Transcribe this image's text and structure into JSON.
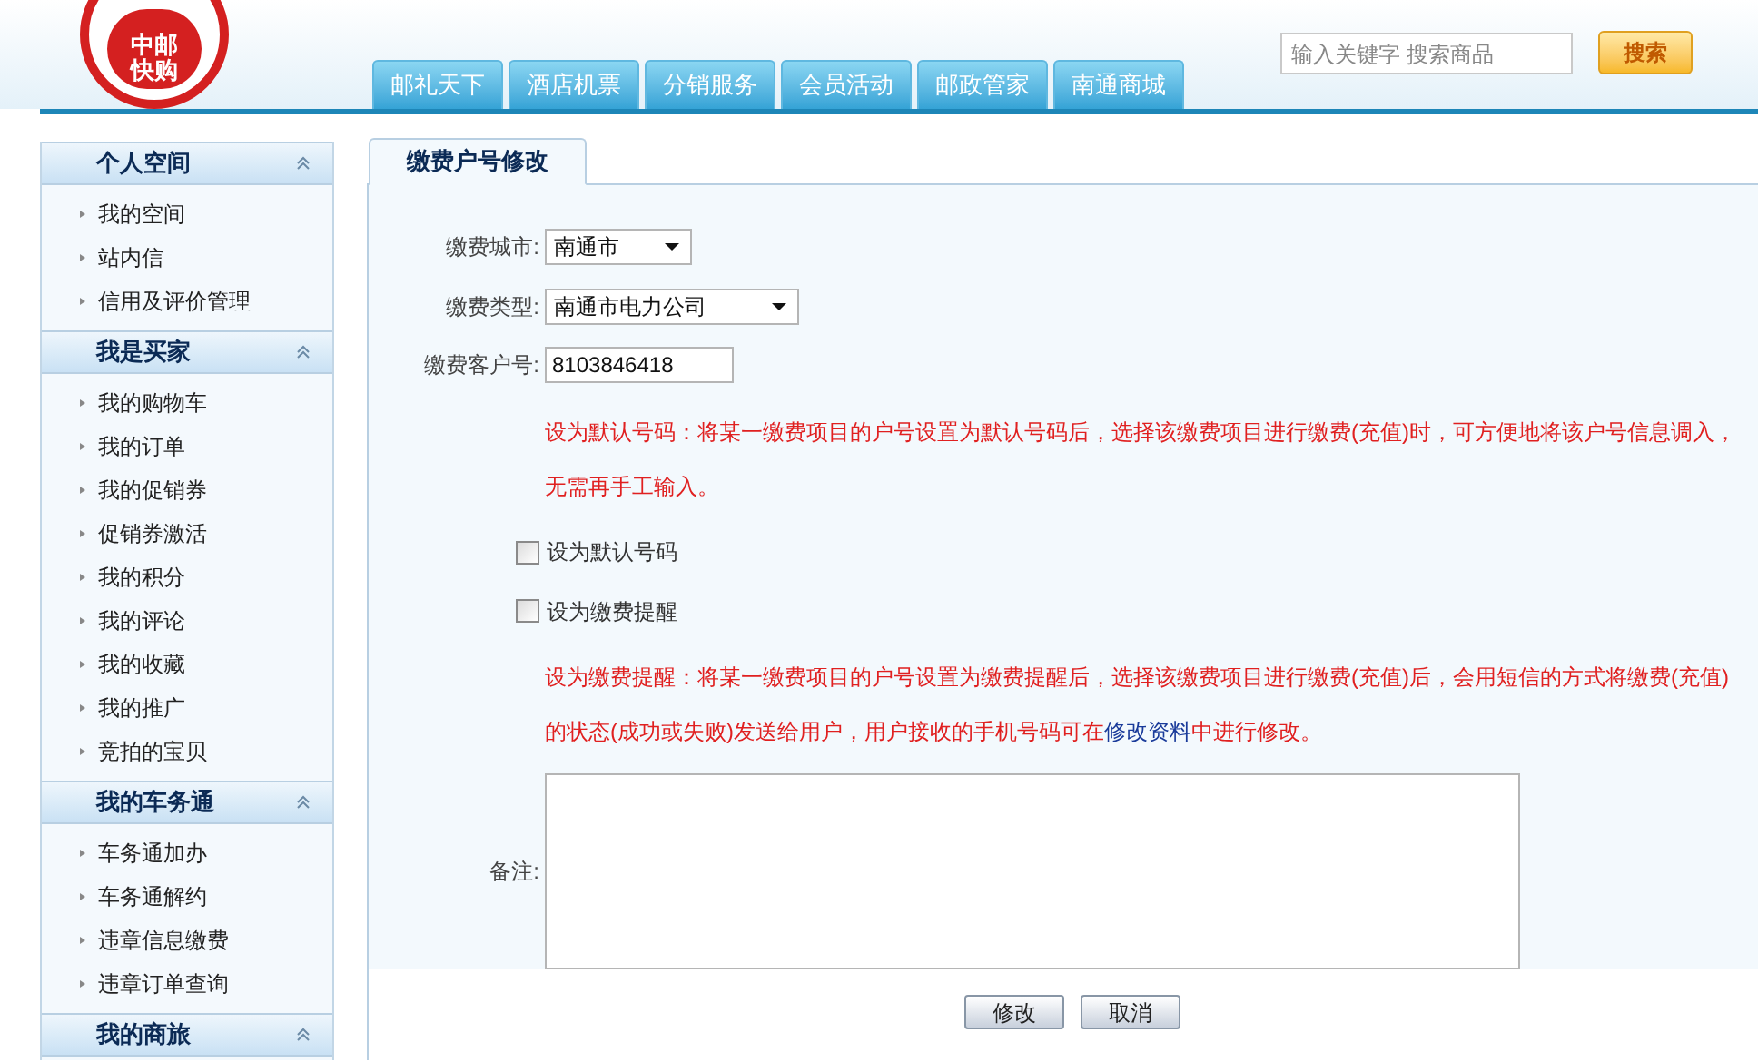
{
  "logo": {
    "line_1": "中邮",
    "line_2": "快购"
  },
  "nav_tabs": [
    {
      "label": "邮礼天下"
    },
    {
      "label": "酒店机票"
    },
    {
      "label": "分销服务"
    },
    {
      "label": "会员活动"
    },
    {
      "label": "邮政管家"
    },
    {
      "label": "南通商城"
    }
  ],
  "search": {
    "placeholder": "输入关键字 搜索商品",
    "button": "搜索"
  },
  "sidebar": [
    {
      "title": "个人空间",
      "expanded": true,
      "items": [
        "我的空间",
        "站内信",
        "信用及评价管理"
      ]
    },
    {
      "title": "我是买家",
      "expanded": true,
      "items": [
        "我的购物车",
        "我的订单",
        "我的促销券",
        "促销券激活",
        "我的积分",
        "我的评论",
        "我的收藏",
        "我的推广",
        "竞拍的宝贝"
      ]
    },
    {
      "title": "我的车务通",
      "expanded": true,
      "items": [
        "车务通加办",
        "车务通解约",
        "违章信息缴费",
        "违章订单查询"
      ]
    },
    {
      "title": "我的商旅",
      "expanded": true
    }
  ],
  "panel": {
    "tab": {
      "label": "缴费户号修改",
      "selected": true
    },
    "form_items": [
      {
        "kind": "select",
        "label": "缴费城市:",
        "value": "南通市"
      },
      {
        "kind": "select",
        "label": "缴费类型:",
        "value": "南通市电力公司"
      },
      {
        "kind": "text",
        "label": "缴费客户号:",
        "value": "8103846418"
      },
      {
        "kind": "note",
        "text": "设为默认号码：将某一缴费项目的户号设置为默认号码后，选择该缴费项目进行缴费(充值)时，可方便地将该户号信息调入，无需再手工输入。"
      },
      {
        "kind": "checkbox",
        "label": "设为默认号码",
        "checked": false
      },
      {
        "kind": "checkbox",
        "label": "设为缴费提醒",
        "checked": false
      },
      {
        "kind": "note",
        "text": "设为缴费提醒：将某一缴费项目的户号设置为缴费提醒后，选择该缴费项目进行缴费(充值)后，会用短信的方式将缴费(充值)的状态(成功或失败)发送给用户，用户接收的手机号码可在",
        "link": "修改资料",
        "text_after": "中进行修改。"
      },
      {
        "kind": "textarea",
        "label": "备注:"
      }
    ],
    "buttons": [
      "修改",
      "取消"
    ]
  }
}
